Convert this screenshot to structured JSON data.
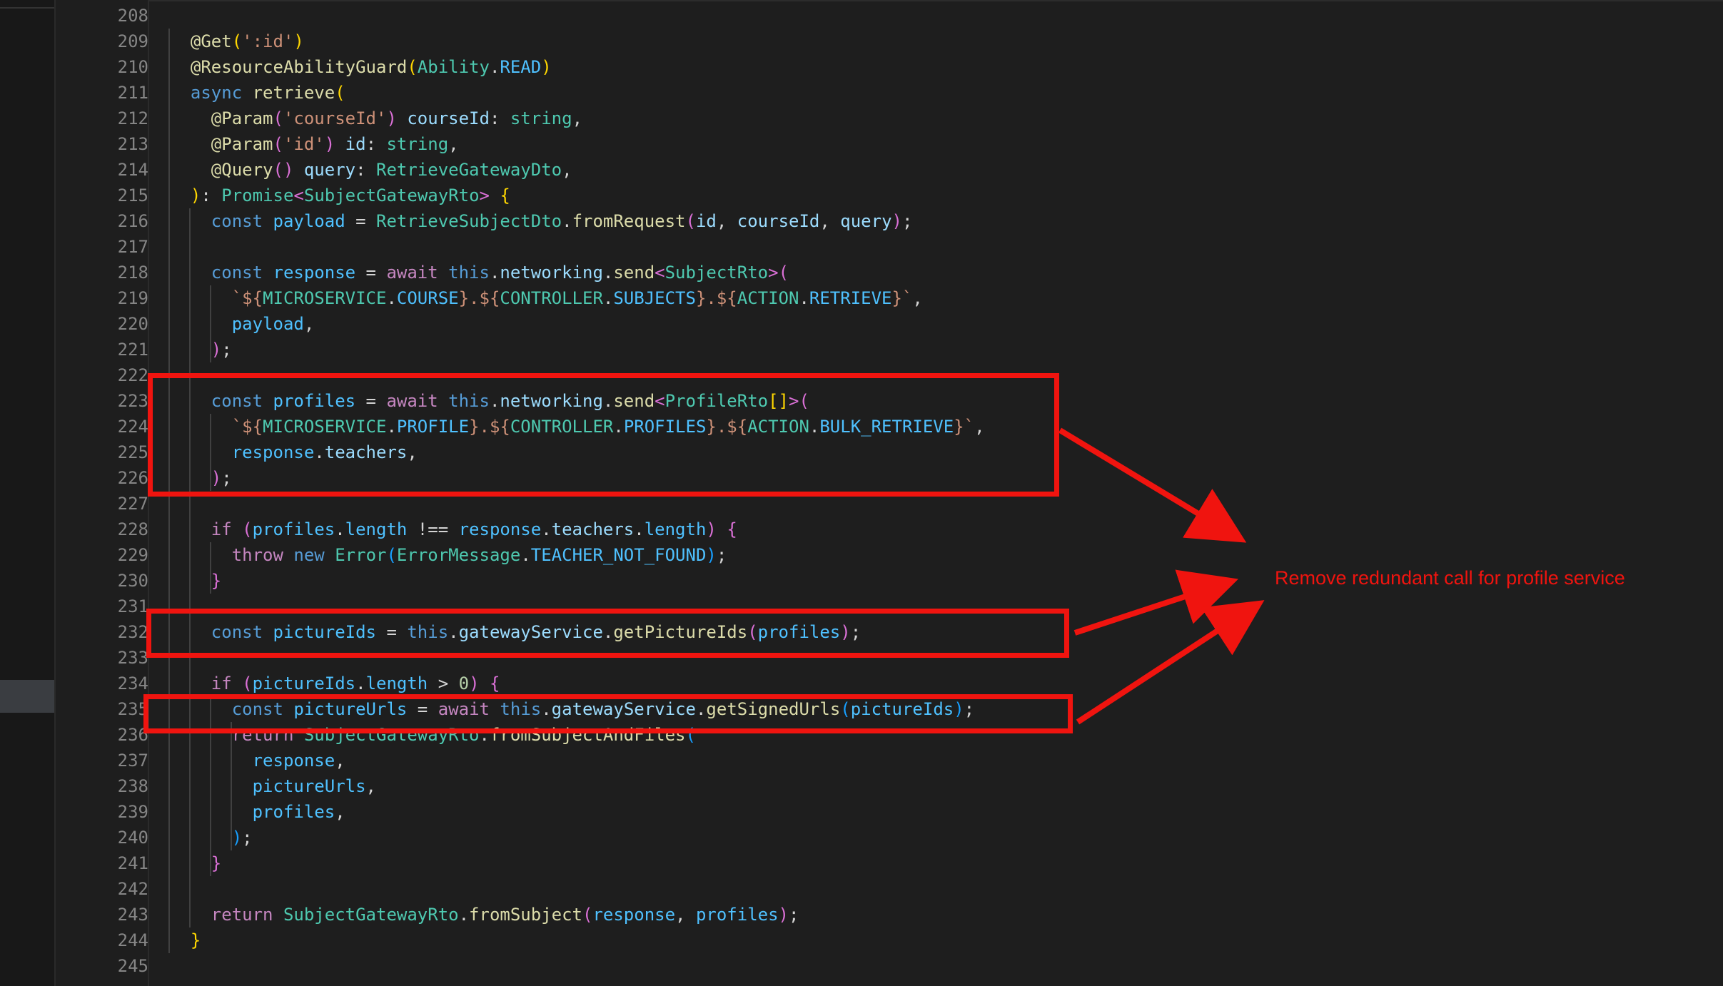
{
  "editor": {
    "accent_annotation_color": "#f0140f",
    "background": "#1e1e1e"
  },
  "line_numbers": [
    "208",
    "209",
    "210",
    "211",
    "212",
    "213",
    "214",
    "215",
    "216",
    "217",
    "218",
    "219",
    "220",
    "221",
    "222",
    "223",
    "224",
    "225",
    "226",
    "227",
    "228",
    "229",
    "230",
    "231",
    "232",
    "233",
    "234",
    "235",
    "236",
    "237",
    "238",
    "239",
    "240",
    "241",
    "242",
    "243",
    "244",
    "245"
  ],
  "code_lines": [
    {
      "num": "208",
      "tokens": []
    },
    {
      "num": "209",
      "tokens": [
        {
          "t": "  "
        },
        {
          "t": "@Get",
          "c": "dec"
        },
        {
          "t": "(",
          "c": "br1"
        },
        {
          "t": "':id'",
          "c": "str"
        },
        {
          "t": ")",
          "c": "br1"
        }
      ]
    },
    {
      "num": "210",
      "tokens": [
        {
          "t": "  "
        },
        {
          "t": "@ResourceAbilityGuard",
          "c": "dec"
        },
        {
          "t": "(",
          "c": "br1"
        },
        {
          "t": "Ability",
          "c": "ty"
        },
        {
          "t": ".",
          "c": "pun"
        },
        {
          "t": "READ",
          "c": "cst"
        },
        {
          "t": ")",
          "c": "br1"
        }
      ]
    },
    {
      "num": "211",
      "tokens": [
        {
          "t": "  "
        },
        {
          "t": "async",
          "c": "kw"
        },
        {
          "t": " "
        },
        {
          "t": "retrieve",
          "c": "fn"
        },
        {
          "t": "(",
          "c": "br1"
        }
      ]
    },
    {
      "num": "212",
      "tokens": [
        {
          "t": "    "
        },
        {
          "t": "@Param",
          "c": "dec"
        },
        {
          "t": "(",
          "c": "br2"
        },
        {
          "t": "'courseId'",
          "c": "str"
        },
        {
          "t": ")",
          "c": "br2"
        },
        {
          "t": " "
        },
        {
          "t": "courseId",
          "c": "var"
        },
        {
          "t": ": ",
          "c": "pun"
        },
        {
          "t": "string",
          "c": "ty"
        },
        {
          "t": ",",
          "c": "pun"
        }
      ]
    },
    {
      "num": "213",
      "tokens": [
        {
          "t": "    "
        },
        {
          "t": "@Param",
          "c": "dec"
        },
        {
          "t": "(",
          "c": "br2"
        },
        {
          "t": "'id'",
          "c": "str"
        },
        {
          "t": ")",
          "c": "br2"
        },
        {
          "t": " "
        },
        {
          "t": "id",
          "c": "var"
        },
        {
          "t": ": ",
          "c": "pun"
        },
        {
          "t": "string",
          "c": "ty"
        },
        {
          "t": ",",
          "c": "pun"
        }
      ]
    },
    {
      "num": "214",
      "tokens": [
        {
          "t": "    "
        },
        {
          "t": "@Query",
          "c": "dec"
        },
        {
          "t": "()",
          "c": "br2"
        },
        {
          "t": " "
        },
        {
          "t": "query",
          "c": "var"
        },
        {
          "t": ": ",
          "c": "pun"
        },
        {
          "t": "RetrieveGatewayDto",
          "c": "ty"
        },
        {
          "t": ",",
          "c": "pun"
        }
      ]
    },
    {
      "num": "215",
      "tokens": [
        {
          "t": "  "
        },
        {
          "t": ")",
          "c": "br1"
        },
        {
          "t": ": ",
          "c": "pun"
        },
        {
          "t": "Promise",
          "c": "ty"
        },
        {
          "t": "<",
          "c": "br2"
        },
        {
          "t": "SubjectGatewayRto",
          "c": "ty"
        },
        {
          "t": ">",
          "c": "br2"
        },
        {
          "t": " "
        },
        {
          "t": "{",
          "c": "br1"
        }
      ]
    },
    {
      "num": "216",
      "tokens": [
        {
          "t": "    "
        },
        {
          "t": "const",
          "c": "kw"
        },
        {
          "t": " "
        },
        {
          "t": "payload",
          "c": "cst"
        },
        {
          "t": " = ",
          "c": "pun"
        },
        {
          "t": "RetrieveSubjectDto",
          "c": "ty"
        },
        {
          "t": ".",
          "c": "pun"
        },
        {
          "t": "fromRequest",
          "c": "fn"
        },
        {
          "t": "(",
          "c": "br2"
        },
        {
          "t": "id",
          "c": "var"
        },
        {
          "t": ", ",
          "c": "pun"
        },
        {
          "t": "courseId",
          "c": "var"
        },
        {
          "t": ", ",
          "c": "pun"
        },
        {
          "t": "query",
          "c": "var"
        },
        {
          "t": ")",
          "c": "br2"
        },
        {
          "t": ";",
          "c": "pun"
        }
      ]
    },
    {
      "num": "217",
      "tokens": []
    },
    {
      "num": "218",
      "tokens": [
        {
          "t": "    "
        },
        {
          "t": "const",
          "c": "kw"
        },
        {
          "t": " "
        },
        {
          "t": "response",
          "c": "cst"
        },
        {
          "t": " = ",
          "c": "pun"
        },
        {
          "t": "await",
          "c": "ctl"
        },
        {
          "t": " "
        },
        {
          "t": "this",
          "c": "kw"
        },
        {
          "t": ".",
          "c": "pun"
        },
        {
          "t": "networking",
          "c": "var"
        },
        {
          "t": ".",
          "c": "pun"
        },
        {
          "t": "send",
          "c": "fn"
        },
        {
          "t": "<",
          "c": "br2"
        },
        {
          "t": "SubjectRto",
          "c": "ty"
        },
        {
          "t": ">",
          "c": "br2"
        },
        {
          "t": "(",
          "c": "br2"
        }
      ]
    },
    {
      "num": "219",
      "tokens": [
        {
          "t": "      "
        },
        {
          "t": "`${",
          "c": "str"
        },
        {
          "t": "MICROSERVICE",
          "c": "ty"
        },
        {
          "t": ".",
          "c": "pun"
        },
        {
          "t": "COURSE",
          "c": "cst"
        },
        {
          "t": "}.${",
          "c": "str"
        },
        {
          "t": "CONTROLLER",
          "c": "ty"
        },
        {
          "t": ".",
          "c": "pun"
        },
        {
          "t": "SUBJECTS",
          "c": "cst"
        },
        {
          "t": "}.${",
          "c": "str"
        },
        {
          "t": "ACTION",
          "c": "ty"
        },
        {
          "t": ".",
          "c": "pun"
        },
        {
          "t": "RETRIEVE",
          "c": "cst"
        },
        {
          "t": "}`",
          "c": "str"
        },
        {
          "t": ",",
          "c": "pun"
        }
      ]
    },
    {
      "num": "220",
      "tokens": [
        {
          "t": "      "
        },
        {
          "t": "payload",
          "c": "cst"
        },
        {
          "t": ",",
          "c": "pun"
        }
      ]
    },
    {
      "num": "221",
      "tokens": [
        {
          "t": "    "
        },
        {
          "t": ")",
          "c": "br2"
        },
        {
          "t": ";",
          "c": "pun"
        }
      ]
    },
    {
      "num": "222",
      "tokens": []
    },
    {
      "num": "223",
      "tokens": [
        {
          "t": "    "
        },
        {
          "t": "const",
          "c": "kw"
        },
        {
          "t": " "
        },
        {
          "t": "profiles",
          "c": "cst"
        },
        {
          "t": " = ",
          "c": "pun"
        },
        {
          "t": "await",
          "c": "ctl"
        },
        {
          "t": " "
        },
        {
          "t": "this",
          "c": "kw"
        },
        {
          "t": ".",
          "c": "pun"
        },
        {
          "t": "networking",
          "c": "var"
        },
        {
          "t": ".",
          "c": "pun"
        },
        {
          "t": "send",
          "c": "fn"
        },
        {
          "t": "<",
          "c": "br2"
        },
        {
          "t": "ProfileRto",
          "c": "ty"
        },
        {
          "t": "[]",
          "c": "br1"
        },
        {
          "t": ">",
          "c": "br2"
        },
        {
          "t": "(",
          "c": "br2"
        }
      ]
    },
    {
      "num": "224",
      "tokens": [
        {
          "t": "      "
        },
        {
          "t": "`${",
          "c": "str"
        },
        {
          "t": "MICROSERVICE",
          "c": "ty"
        },
        {
          "t": ".",
          "c": "pun"
        },
        {
          "t": "PROFILE",
          "c": "cst"
        },
        {
          "t": "}.${",
          "c": "str"
        },
        {
          "t": "CONTROLLER",
          "c": "ty"
        },
        {
          "t": ".",
          "c": "pun"
        },
        {
          "t": "PROFILES",
          "c": "cst"
        },
        {
          "t": "}.${",
          "c": "str"
        },
        {
          "t": "ACTION",
          "c": "ty"
        },
        {
          "t": ".",
          "c": "pun"
        },
        {
          "t": "BULK_RETRIEVE",
          "c": "cst"
        },
        {
          "t": "}`",
          "c": "str"
        },
        {
          "t": ",",
          "c": "pun"
        }
      ]
    },
    {
      "num": "225",
      "tokens": [
        {
          "t": "      "
        },
        {
          "t": "response",
          "c": "cst"
        },
        {
          "t": ".",
          "c": "pun"
        },
        {
          "t": "teachers",
          "c": "var"
        },
        {
          "t": ",",
          "c": "pun"
        }
      ]
    },
    {
      "num": "226",
      "tokens": [
        {
          "t": "    "
        },
        {
          "t": ")",
          "c": "br2"
        },
        {
          "t": ";",
          "c": "pun"
        }
      ]
    },
    {
      "num": "227",
      "tokens": []
    },
    {
      "num": "228",
      "tokens": [
        {
          "t": "    "
        },
        {
          "t": "if",
          "c": "ctl"
        },
        {
          "t": " "
        },
        {
          "t": "(",
          "c": "br2"
        },
        {
          "t": "profiles",
          "c": "cst"
        },
        {
          "t": ".",
          "c": "pun"
        },
        {
          "t": "length",
          "c": "cst"
        },
        {
          "t": " !== ",
          "c": "pun"
        },
        {
          "t": "response",
          "c": "cst"
        },
        {
          "t": ".",
          "c": "pun"
        },
        {
          "t": "teachers",
          "c": "var"
        },
        {
          "t": ".",
          "c": "pun"
        },
        {
          "t": "length",
          "c": "cst"
        },
        {
          "t": ")",
          "c": "br2"
        },
        {
          "t": " "
        },
        {
          "t": "{",
          "c": "br2"
        }
      ]
    },
    {
      "num": "229",
      "tokens": [
        {
          "t": "      "
        },
        {
          "t": "throw",
          "c": "ctl"
        },
        {
          "t": " "
        },
        {
          "t": "new",
          "c": "kw"
        },
        {
          "t": " "
        },
        {
          "t": "Error",
          "c": "ty"
        },
        {
          "t": "(",
          "c": "br3"
        },
        {
          "t": "ErrorMessage",
          "c": "ty"
        },
        {
          "t": ".",
          "c": "pun"
        },
        {
          "t": "TEACHER_NOT_FOUND",
          "c": "cst"
        },
        {
          "t": ")",
          "c": "br3"
        },
        {
          "t": ";",
          "c": "pun"
        }
      ]
    },
    {
      "num": "230",
      "tokens": [
        {
          "t": "    "
        },
        {
          "t": "}",
          "c": "br2"
        }
      ]
    },
    {
      "num": "231",
      "tokens": []
    },
    {
      "num": "232",
      "tokens": [
        {
          "t": "    "
        },
        {
          "t": "const",
          "c": "kw"
        },
        {
          "t": " "
        },
        {
          "t": "pictureIds",
          "c": "cst"
        },
        {
          "t": " = ",
          "c": "pun"
        },
        {
          "t": "this",
          "c": "kw"
        },
        {
          "t": ".",
          "c": "pun"
        },
        {
          "t": "gatewayService",
          "c": "var"
        },
        {
          "t": ".",
          "c": "pun"
        },
        {
          "t": "getPictureIds",
          "c": "fn"
        },
        {
          "t": "(",
          "c": "br2"
        },
        {
          "t": "profiles",
          "c": "cst"
        },
        {
          "t": ")",
          "c": "br2"
        },
        {
          "t": ";",
          "c": "pun"
        }
      ]
    },
    {
      "num": "233",
      "tokens": []
    },
    {
      "num": "234",
      "tokens": [
        {
          "t": "    "
        },
        {
          "t": "if",
          "c": "ctl"
        },
        {
          "t": " "
        },
        {
          "t": "(",
          "c": "br2"
        },
        {
          "t": "pictureIds",
          "c": "cst"
        },
        {
          "t": ".",
          "c": "pun"
        },
        {
          "t": "length",
          "c": "cst"
        },
        {
          "t": " > ",
          "c": "pun"
        },
        {
          "t": "0",
          "c": "num"
        },
        {
          "t": ")",
          "c": "br2"
        },
        {
          "t": " "
        },
        {
          "t": "{",
          "c": "br2"
        }
      ]
    },
    {
      "num": "235",
      "tokens": [
        {
          "t": "      "
        },
        {
          "t": "const",
          "c": "kw"
        },
        {
          "t": " "
        },
        {
          "t": "pictureUrls",
          "c": "cst"
        },
        {
          "t": " = ",
          "c": "pun"
        },
        {
          "t": "await",
          "c": "ctl"
        },
        {
          "t": " "
        },
        {
          "t": "this",
          "c": "kw"
        },
        {
          "t": ".",
          "c": "pun"
        },
        {
          "t": "gatewayService",
          "c": "var"
        },
        {
          "t": ".",
          "c": "pun"
        },
        {
          "t": "getSignedUrls",
          "c": "fn"
        },
        {
          "t": "(",
          "c": "br3"
        },
        {
          "t": "pictureIds",
          "c": "cst"
        },
        {
          "t": ")",
          "c": "br3"
        },
        {
          "t": ";",
          "c": "pun"
        }
      ]
    },
    {
      "num": "236",
      "tokens": [
        {
          "t": "      "
        },
        {
          "t": "return",
          "c": "ctl"
        },
        {
          "t": " "
        },
        {
          "t": "SubjectGatewayRto",
          "c": "ty"
        },
        {
          "t": ".",
          "c": "pun"
        },
        {
          "t": "fromSubjectAndFiles",
          "c": "fn"
        },
        {
          "t": "(",
          "c": "br3"
        }
      ]
    },
    {
      "num": "237",
      "tokens": [
        {
          "t": "        "
        },
        {
          "t": "response",
          "c": "cst"
        },
        {
          "t": ",",
          "c": "pun"
        }
      ]
    },
    {
      "num": "238",
      "tokens": [
        {
          "t": "        "
        },
        {
          "t": "pictureUrls",
          "c": "cst"
        },
        {
          "t": ",",
          "c": "pun"
        }
      ]
    },
    {
      "num": "239",
      "tokens": [
        {
          "t": "        "
        },
        {
          "t": "profiles",
          "c": "cst"
        },
        {
          "t": ",",
          "c": "pun"
        }
      ]
    },
    {
      "num": "240",
      "tokens": [
        {
          "t": "      "
        },
        {
          "t": ")",
          "c": "br3"
        },
        {
          "t": ";",
          "c": "pun"
        }
      ]
    },
    {
      "num": "241",
      "tokens": [
        {
          "t": "    "
        },
        {
          "t": "}",
          "c": "br2"
        }
      ]
    },
    {
      "num": "242",
      "tokens": []
    },
    {
      "num": "243",
      "tokens": [
        {
          "t": "    "
        },
        {
          "t": "return",
          "c": "ctl"
        },
        {
          "t": " "
        },
        {
          "t": "SubjectGatewayRto",
          "c": "ty"
        },
        {
          "t": ".",
          "c": "pun"
        },
        {
          "t": "fromSubject",
          "c": "fn"
        },
        {
          "t": "(",
          "c": "br2"
        },
        {
          "t": "response",
          "c": "cst"
        },
        {
          "t": ", ",
          "c": "pun"
        },
        {
          "t": "profiles",
          "c": "cst"
        },
        {
          "t": ")",
          "c": "br2"
        },
        {
          "t": ";",
          "c": "pun"
        }
      ]
    },
    {
      "num": "244",
      "tokens": [
        {
          "t": "  "
        },
        {
          "t": "}",
          "c": "br1"
        }
      ]
    },
    {
      "num": "245",
      "tokens": []
    }
  ],
  "annotation": {
    "text": "Remove redundant call for profile service"
  }
}
